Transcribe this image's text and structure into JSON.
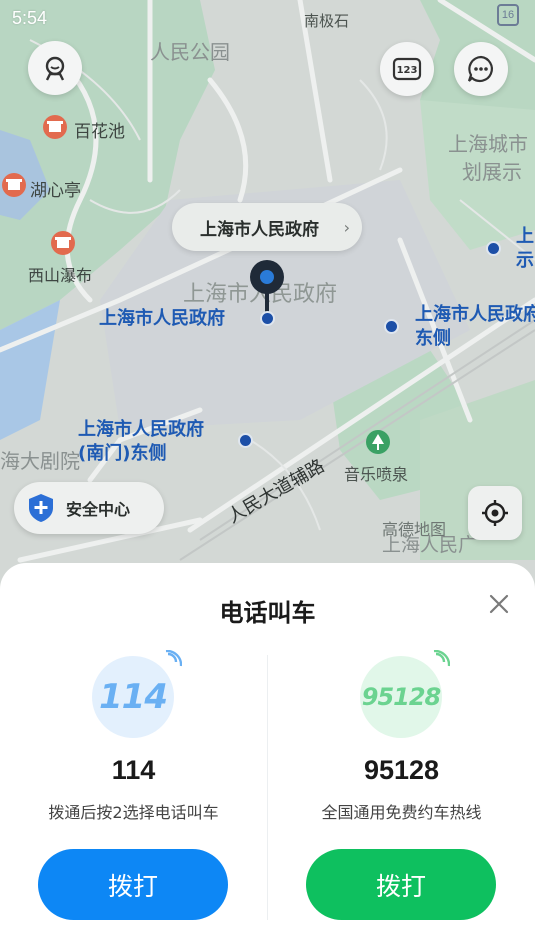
{
  "status": {
    "time": "5:54",
    "badge": "16"
  },
  "map": {
    "labels": {
      "nanjishi": "南极石",
      "renmin_park": "人民公园",
      "baihuachi": "百花池",
      "huxinting": "湖心亭",
      "xishan_pubu": "西山瀑布",
      "urban_exhibit_1": "上海城市",
      "urban_exhibit_2": "划展示",
      "shi_1": "上",
      "shi_2": "示",
      "area_label": "上海市人民政府",
      "poi_main": "上海市人民政府",
      "poi_east_1": "上海市人民政府",
      "poi_east_2": "东侧",
      "poi_south_1": "上海市人民政府",
      "poi_south_2": "(南门)东侧",
      "grand_theatre": "海大剧院",
      "road": "人民大道辅路",
      "fountain": "音乐喷泉",
      "bottom_label": "上海人民广"
    },
    "callout": {
      "title": "上海市人民政府",
      "arrow": "›"
    },
    "safety_center": "安全中心",
    "watermark": "高德地图"
  },
  "sheet": {
    "title": "电话叫车",
    "options": [
      {
        "logo_text": "114",
        "number": "114",
        "desc": "拨通后按2选择电话叫车",
        "button": "拨打",
        "color": "#0d87f5",
        "logo_bg": "#e3f0fd",
        "logo_color": "#6ab0f3"
      },
      {
        "logo_text": "95128",
        "number": "95128",
        "desc": "全国通用免费约车热线",
        "button": "拨打",
        "color": "#0ec05f",
        "logo_bg": "#e1f7e9",
        "logo_color": "#6bd390"
      }
    ]
  }
}
